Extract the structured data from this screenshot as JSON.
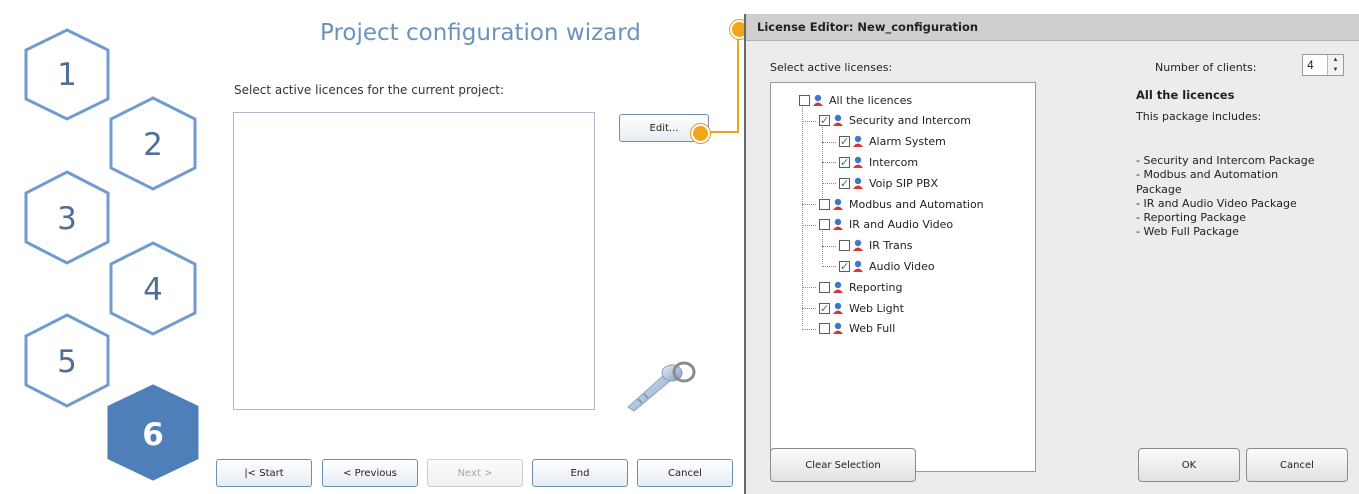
{
  "wizard": {
    "title": "Project configuration wizard",
    "instruction": "Select active licences for the current project:",
    "edit_button": "Edit...",
    "steps": [
      "1",
      "2",
      "3",
      "4",
      "5",
      "6"
    ],
    "active_step": "6",
    "nav": {
      "start": "|< Start",
      "previous": "< Previous",
      "next": "Next >",
      "end": "End",
      "cancel": "Cancel"
    }
  },
  "license_editor": {
    "title": "License Editor: New_configuration",
    "select_label": "Select active licenses:",
    "clients_label": "Number of clients:",
    "clients_value": "4",
    "tree": [
      {
        "label": "All the licences",
        "checked": false
      },
      {
        "label": "Security and Intercom",
        "checked": true
      },
      {
        "label": "Alarm System",
        "checked": true
      },
      {
        "label": "Intercom",
        "checked": true
      },
      {
        "label": "Voip SIP PBX",
        "checked": true
      },
      {
        "label": "Modbus and Automation",
        "checked": false
      },
      {
        "label": "IR and Audio Video",
        "checked": false
      },
      {
        "label": "IR Trans",
        "checked": false
      },
      {
        "label": "Audio Video",
        "checked": true
      },
      {
        "label": "Reporting",
        "checked": false
      },
      {
        "label": "Web Light",
        "checked": true
      },
      {
        "label": "Web Full",
        "checked": false
      }
    ],
    "description": {
      "heading": "All the licences",
      "intro": "This package includes:",
      "items": [
        "- Security and Intercom Package",
        "- Modbus and Automation",
        "Package",
        "- IR and Audio Video Package",
        "- Reporting Package",
        "- Web Full Package"
      ]
    },
    "buttons": {
      "clear": "Clear Selection",
      "ok": "OK",
      "cancel": "Cancel"
    }
  },
  "colors": {
    "hex_outline": "#6f9bd0",
    "hex_active_fill": "#4f7fb8",
    "title_blue": "#6a93bf",
    "callout_orange": "#f3a51a"
  }
}
